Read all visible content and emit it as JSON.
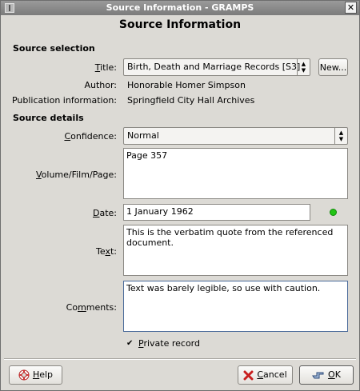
{
  "window": {
    "title": "Source Information - GRAMPS",
    "close_glyph": "✕"
  },
  "dialog": {
    "heading": "Source Information"
  },
  "source_selection": {
    "header": "Source selection",
    "title_label": "Title:",
    "title_value": "Birth, Death and Marriage Records [S3]",
    "new_button": "New...",
    "author_label": "Author:",
    "author_value": "Honorable Homer Simpson",
    "pubinfo_label": "Publication information:",
    "pubinfo_value": "Springfield City Hall Archives"
  },
  "source_details": {
    "header": "Source details",
    "confidence_label": "Confidence:",
    "confidence_value": "Normal",
    "volume_label": "Volume/Film/Page:",
    "volume_value": "Page 357",
    "date_label": "Date:",
    "date_value": "1 January 1962",
    "date_status_color": "#22c414",
    "text_label": "Text:",
    "text_value": "This is the verbatim quote from the referenced\ndocument.",
    "comments_label": "Comments:",
    "comments_value": "Text was barely legible, so use with caution.",
    "private_label": "Private record",
    "private_checked": true
  },
  "buttons": {
    "help": "Help",
    "cancel": "Cancel",
    "ok": "OK"
  },
  "icons": {
    "help": "lifebuoy-icon",
    "cancel": "red-x-icon",
    "ok": "hand-pointer-icon"
  }
}
